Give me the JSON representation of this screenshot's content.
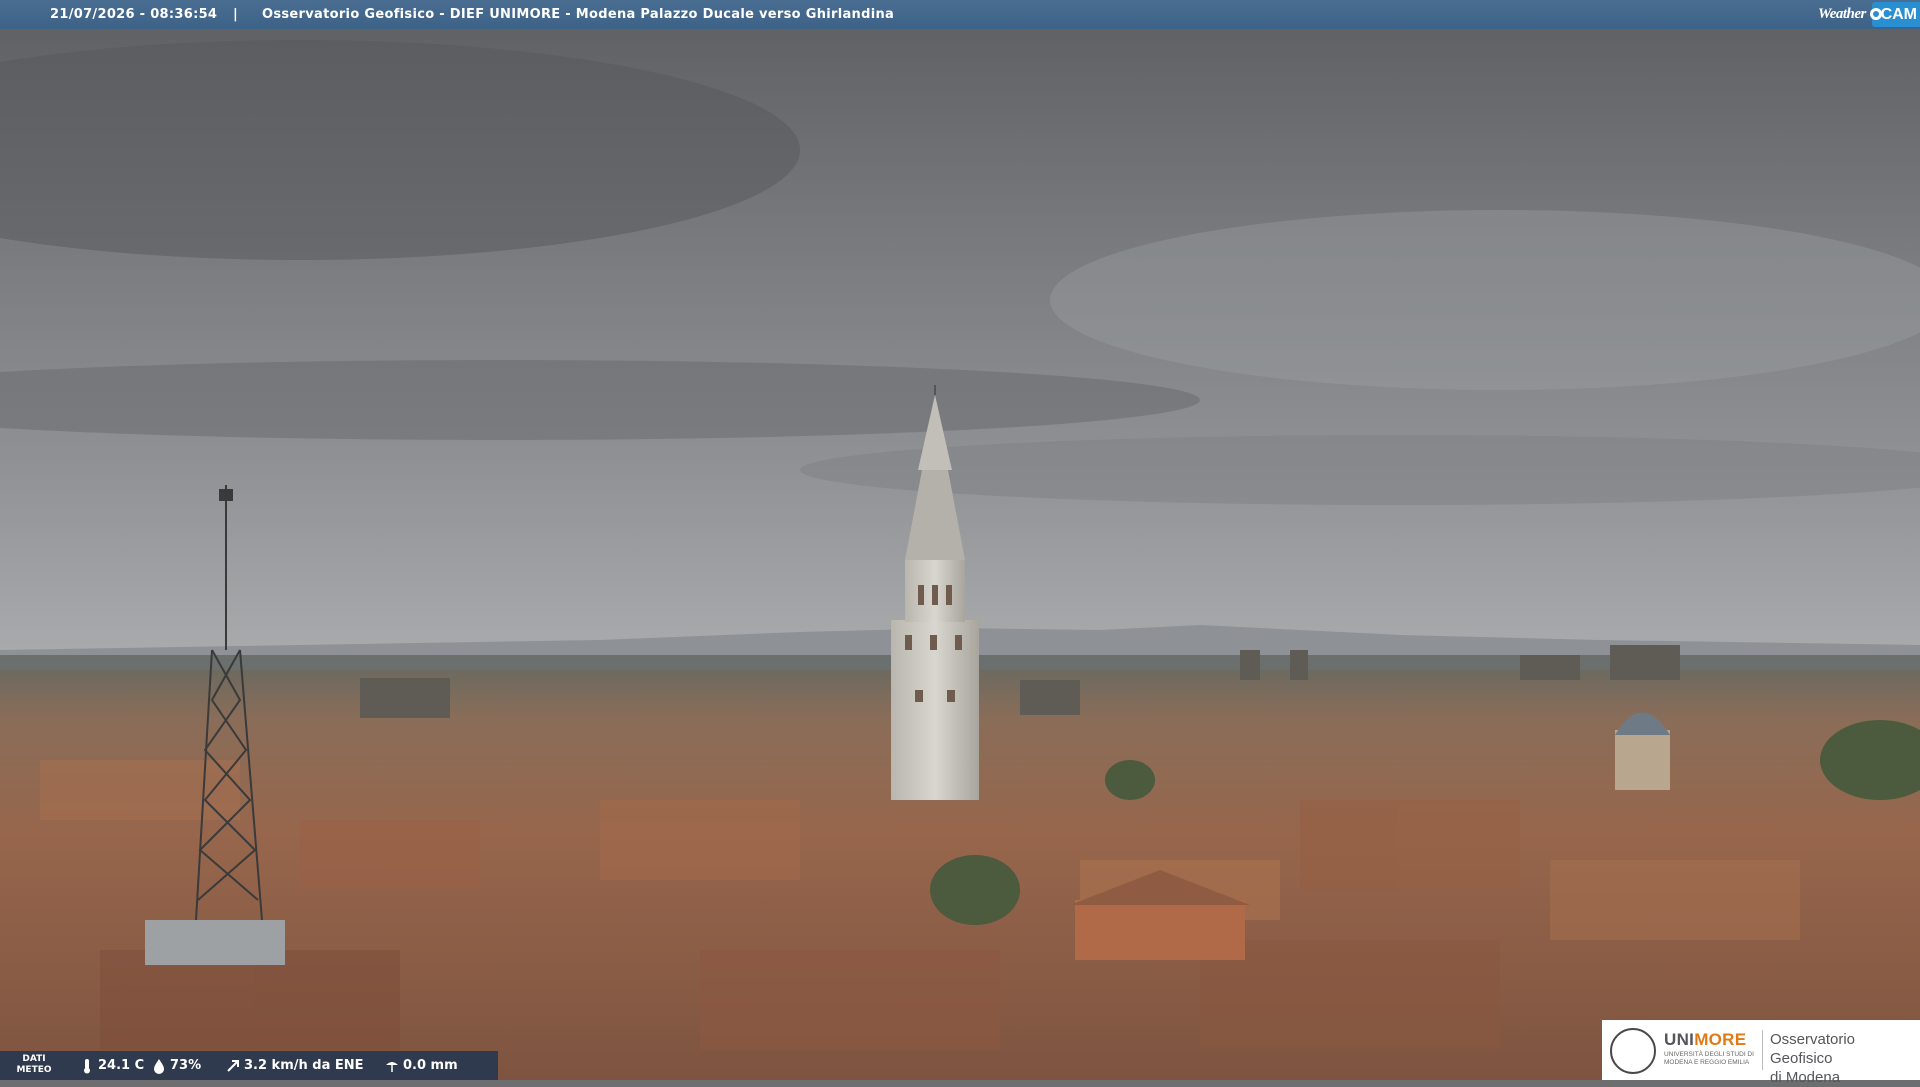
{
  "header": {
    "timestamp": "21/07/2026 - 08:36:54",
    "separator": "|",
    "title": "Osservatorio Geofisico - DIEF UNIMORE - Modena Palazzo Ducale verso Ghirlandina"
  },
  "weathercam_logo": {
    "weather": "Weather",
    "cam": "CAM"
  },
  "weather_data": {
    "label_line1": "DATI",
    "label_line2": "METEO",
    "temperature": "24.1 C",
    "humidity": "73%",
    "wind": "3.2 km/h da ENE",
    "rain": "0.0 mm"
  },
  "unimore_logo": {
    "brand_uni": "UNI",
    "brand_more": "MORE",
    "subtitle": "UNIVERSITÀ DEGLI STUDI DI MODENA E REGGIO EMILIA",
    "observatory_line1": "Osservatorio Geofisico",
    "observatory_line2": "di Modena"
  },
  "colors": {
    "header_bg": "#3d6287",
    "cam_blue": "#2a8fd0",
    "unimore_orange": "#e07a16"
  }
}
